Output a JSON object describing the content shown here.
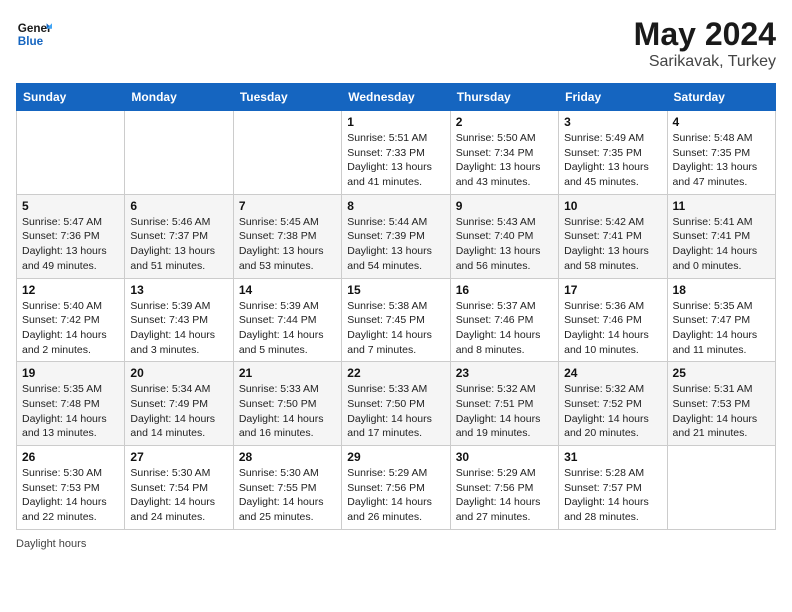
{
  "header": {
    "logo_line1": "General",
    "logo_line2": "Blue",
    "month_year": "May 2024",
    "location": "Sarikavak, Turkey"
  },
  "days_of_week": [
    "Sunday",
    "Monday",
    "Tuesday",
    "Wednesday",
    "Thursday",
    "Friday",
    "Saturday"
  ],
  "weeks": [
    [
      {
        "day": "",
        "sunrise": "",
        "sunset": "",
        "daylight": ""
      },
      {
        "day": "",
        "sunrise": "",
        "sunset": "",
        "daylight": ""
      },
      {
        "day": "",
        "sunrise": "",
        "sunset": "",
        "daylight": ""
      },
      {
        "day": "1",
        "sunrise": "Sunrise: 5:51 AM",
        "sunset": "Sunset: 7:33 PM",
        "daylight": "Daylight: 13 hours and 41 minutes."
      },
      {
        "day": "2",
        "sunrise": "Sunrise: 5:50 AM",
        "sunset": "Sunset: 7:34 PM",
        "daylight": "Daylight: 13 hours and 43 minutes."
      },
      {
        "day": "3",
        "sunrise": "Sunrise: 5:49 AM",
        "sunset": "Sunset: 7:35 PM",
        "daylight": "Daylight: 13 hours and 45 minutes."
      },
      {
        "day": "4",
        "sunrise": "Sunrise: 5:48 AM",
        "sunset": "Sunset: 7:35 PM",
        "daylight": "Daylight: 13 hours and 47 minutes."
      }
    ],
    [
      {
        "day": "5",
        "sunrise": "Sunrise: 5:47 AM",
        "sunset": "Sunset: 7:36 PM",
        "daylight": "Daylight: 13 hours and 49 minutes."
      },
      {
        "day": "6",
        "sunrise": "Sunrise: 5:46 AM",
        "sunset": "Sunset: 7:37 PM",
        "daylight": "Daylight: 13 hours and 51 minutes."
      },
      {
        "day": "7",
        "sunrise": "Sunrise: 5:45 AM",
        "sunset": "Sunset: 7:38 PM",
        "daylight": "Daylight: 13 hours and 53 minutes."
      },
      {
        "day": "8",
        "sunrise": "Sunrise: 5:44 AM",
        "sunset": "Sunset: 7:39 PM",
        "daylight": "Daylight: 13 hours and 54 minutes."
      },
      {
        "day": "9",
        "sunrise": "Sunrise: 5:43 AM",
        "sunset": "Sunset: 7:40 PM",
        "daylight": "Daylight: 13 hours and 56 minutes."
      },
      {
        "day": "10",
        "sunrise": "Sunrise: 5:42 AM",
        "sunset": "Sunset: 7:41 PM",
        "daylight": "Daylight: 13 hours and 58 minutes."
      },
      {
        "day": "11",
        "sunrise": "Sunrise: 5:41 AM",
        "sunset": "Sunset: 7:41 PM",
        "daylight": "Daylight: 14 hours and 0 minutes."
      }
    ],
    [
      {
        "day": "12",
        "sunrise": "Sunrise: 5:40 AM",
        "sunset": "Sunset: 7:42 PM",
        "daylight": "Daylight: 14 hours and 2 minutes."
      },
      {
        "day": "13",
        "sunrise": "Sunrise: 5:39 AM",
        "sunset": "Sunset: 7:43 PM",
        "daylight": "Daylight: 14 hours and 3 minutes."
      },
      {
        "day": "14",
        "sunrise": "Sunrise: 5:39 AM",
        "sunset": "Sunset: 7:44 PM",
        "daylight": "Daylight: 14 hours and 5 minutes."
      },
      {
        "day": "15",
        "sunrise": "Sunrise: 5:38 AM",
        "sunset": "Sunset: 7:45 PM",
        "daylight": "Daylight: 14 hours and 7 minutes."
      },
      {
        "day": "16",
        "sunrise": "Sunrise: 5:37 AM",
        "sunset": "Sunset: 7:46 PM",
        "daylight": "Daylight: 14 hours and 8 minutes."
      },
      {
        "day": "17",
        "sunrise": "Sunrise: 5:36 AM",
        "sunset": "Sunset: 7:46 PM",
        "daylight": "Daylight: 14 hours and 10 minutes."
      },
      {
        "day": "18",
        "sunrise": "Sunrise: 5:35 AM",
        "sunset": "Sunset: 7:47 PM",
        "daylight": "Daylight: 14 hours and 11 minutes."
      }
    ],
    [
      {
        "day": "19",
        "sunrise": "Sunrise: 5:35 AM",
        "sunset": "Sunset: 7:48 PM",
        "daylight": "Daylight: 14 hours and 13 minutes."
      },
      {
        "day": "20",
        "sunrise": "Sunrise: 5:34 AM",
        "sunset": "Sunset: 7:49 PM",
        "daylight": "Daylight: 14 hours and 14 minutes."
      },
      {
        "day": "21",
        "sunrise": "Sunrise: 5:33 AM",
        "sunset": "Sunset: 7:50 PM",
        "daylight": "Daylight: 14 hours and 16 minutes."
      },
      {
        "day": "22",
        "sunrise": "Sunrise: 5:33 AM",
        "sunset": "Sunset: 7:50 PM",
        "daylight": "Daylight: 14 hours and 17 minutes."
      },
      {
        "day": "23",
        "sunrise": "Sunrise: 5:32 AM",
        "sunset": "Sunset: 7:51 PM",
        "daylight": "Daylight: 14 hours and 19 minutes."
      },
      {
        "day": "24",
        "sunrise": "Sunrise: 5:32 AM",
        "sunset": "Sunset: 7:52 PM",
        "daylight": "Daylight: 14 hours and 20 minutes."
      },
      {
        "day": "25",
        "sunrise": "Sunrise: 5:31 AM",
        "sunset": "Sunset: 7:53 PM",
        "daylight": "Daylight: 14 hours and 21 minutes."
      }
    ],
    [
      {
        "day": "26",
        "sunrise": "Sunrise: 5:30 AM",
        "sunset": "Sunset: 7:53 PM",
        "daylight": "Daylight: 14 hours and 22 minutes."
      },
      {
        "day": "27",
        "sunrise": "Sunrise: 5:30 AM",
        "sunset": "Sunset: 7:54 PM",
        "daylight": "Daylight: 14 hours and 24 minutes."
      },
      {
        "day": "28",
        "sunrise": "Sunrise: 5:30 AM",
        "sunset": "Sunset: 7:55 PM",
        "daylight": "Daylight: 14 hours and 25 minutes."
      },
      {
        "day": "29",
        "sunrise": "Sunrise: 5:29 AM",
        "sunset": "Sunset: 7:56 PM",
        "daylight": "Daylight: 14 hours and 26 minutes."
      },
      {
        "day": "30",
        "sunrise": "Sunrise: 5:29 AM",
        "sunset": "Sunset: 7:56 PM",
        "daylight": "Daylight: 14 hours and 27 minutes."
      },
      {
        "day": "31",
        "sunrise": "Sunrise: 5:28 AM",
        "sunset": "Sunset: 7:57 PM",
        "daylight": "Daylight: 14 hours and 28 minutes."
      },
      {
        "day": "",
        "sunrise": "",
        "sunset": "",
        "daylight": ""
      }
    ]
  ],
  "footer": {
    "daylight_label": "Daylight hours"
  }
}
